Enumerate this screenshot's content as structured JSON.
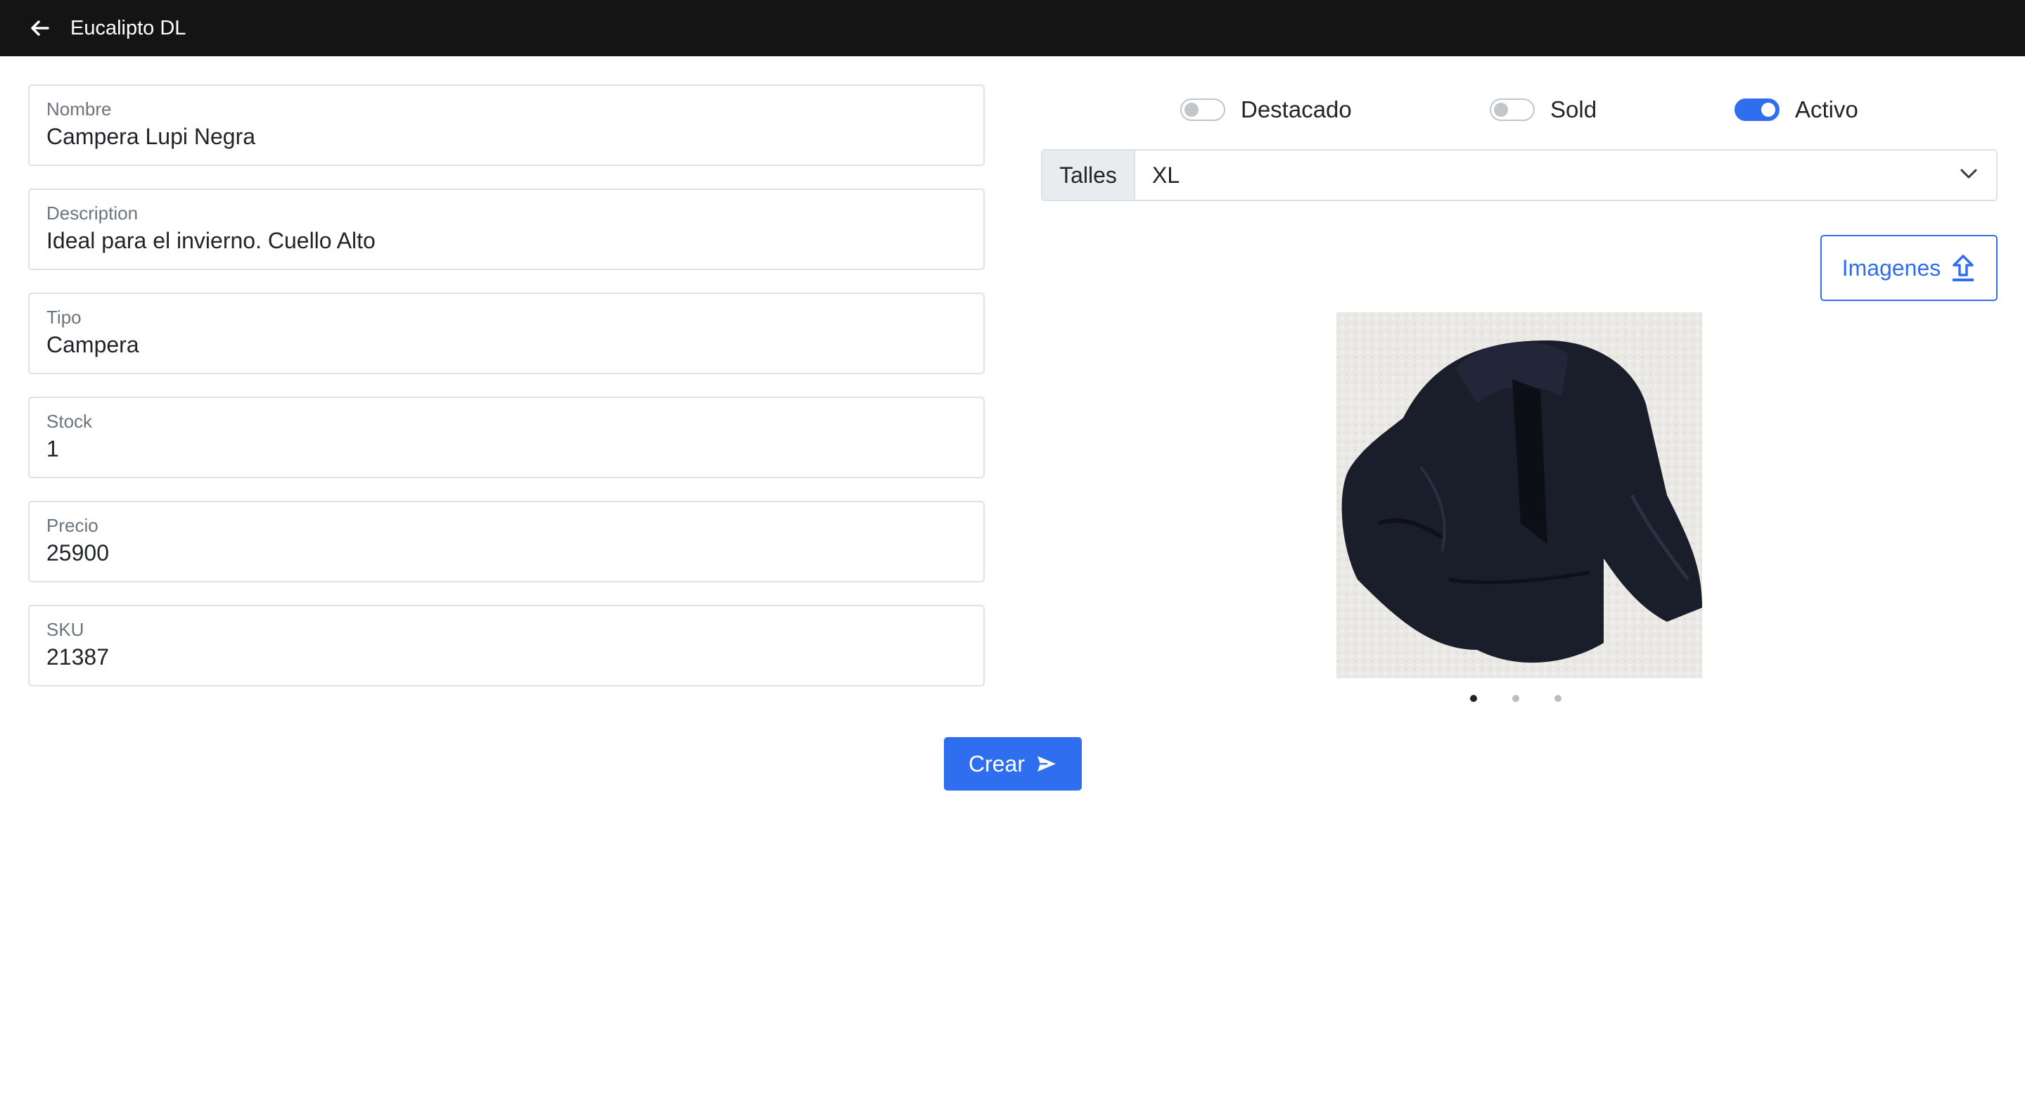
{
  "header": {
    "title": "Eucalipto DL",
    "back_icon": "arrow-left-icon",
    "background": "#141414"
  },
  "form": {
    "fields": [
      {
        "label": "Nombre",
        "value": "Campera Lupi Negra"
      },
      {
        "label": "Description",
        "value": "Ideal para el invierno. Cuello Alto"
      },
      {
        "label": "Tipo",
        "value": "Campera"
      },
      {
        "label": "Stock",
        "value": "1"
      },
      {
        "label": "Precio",
        "value": "25900"
      },
      {
        "label": "SKU",
        "value": "21387"
      }
    ]
  },
  "toggles": [
    {
      "label": "Destacado",
      "checked": false
    },
    {
      "label": "Sold",
      "checked": false
    },
    {
      "label": "Activo",
      "checked": true
    }
  ],
  "sizes": {
    "prefix": "Talles",
    "selected": "XL",
    "icon": "chevron-down-icon"
  },
  "images": {
    "upload_label": "Imagenes",
    "upload_icon": "upload-icon",
    "carousel_count": 3,
    "active_index": 0,
    "photo_subject": "black-jacket-photo"
  },
  "actions": {
    "submit_label": "Crear",
    "submit_icon": "send-icon"
  },
  "colors": {
    "accent": "#2f6fef",
    "border": "#dee2e6",
    "muted": "#6c757d"
  }
}
